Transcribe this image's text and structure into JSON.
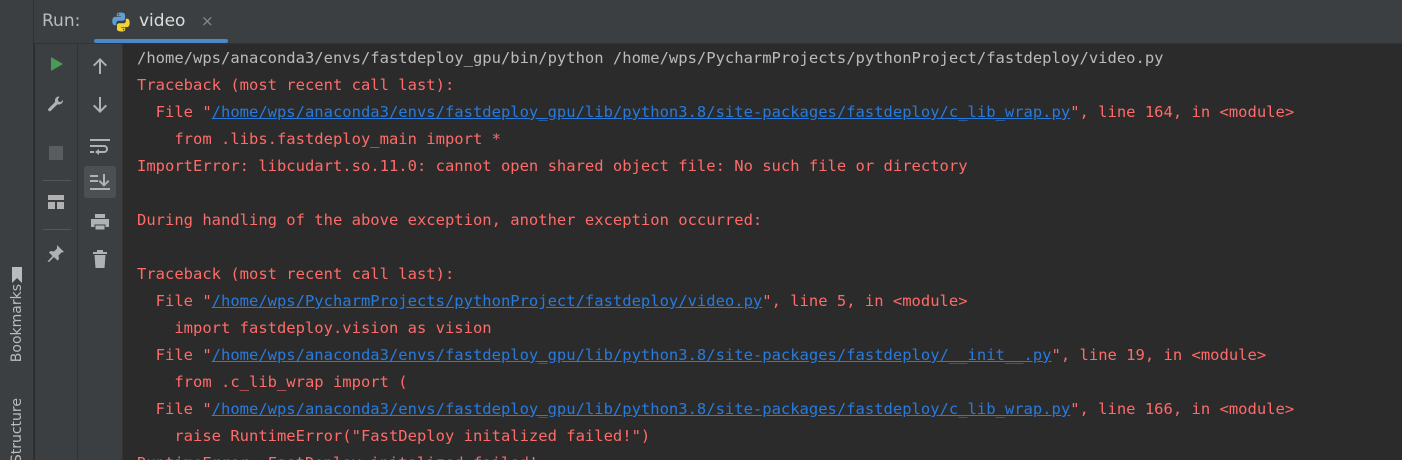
{
  "side_stripe": {
    "bookmarks_label": "Bookmarks",
    "structure_label": "Structure"
  },
  "header": {
    "run_label": "Run:",
    "tab": {
      "title": "video",
      "icon": "python-icon",
      "close_glyph": "×"
    }
  },
  "toolbar": {
    "left": [
      {
        "name": "rerun-icon"
      },
      {
        "name": "wrench-icon"
      },
      {
        "name": "stop-icon"
      },
      {
        "name": "layout-icon"
      },
      {
        "name": "pin-icon"
      }
    ],
    "right": [
      {
        "name": "up-arrow-icon"
      },
      {
        "name": "down-arrow-icon"
      },
      {
        "name": "soft-wrap-icon"
      },
      {
        "name": "scroll-to-end-icon"
      },
      {
        "name": "print-icon"
      },
      {
        "name": "trash-icon"
      }
    ]
  },
  "colors": {
    "error": "#ff6b68",
    "link": "#287bde",
    "normal": "#bbbbbb",
    "background": "#2b2b2b",
    "accent": "#4a88c7"
  },
  "console": {
    "cmd": "/home/wps/anaconda3/envs/fastdeploy_gpu/bin/python /home/wps/PycharmProjects/pythonProject/fastdeploy/video.py",
    "tb1_header": "Traceback (most recent call last):",
    "f1_pre": "  File \"",
    "f1_link": "/home/wps/anaconda3/envs/fastdeploy_gpu/lib/python3.8/site-packages/fastdeploy/c_lib_wrap.py",
    "f1_post": "\", line 164, in <module>",
    "f1_code": "    from .libs.fastdeploy_main import *",
    "import_error": "ImportError: libcudart.so.11.0: cannot open shared object file: No such file or directory",
    "during": "During handling of the above exception, another exception occurred:",
    "tb2_header": "Traceback (most recent call last):",
    "f2_pre": "  File \"",
    "f2_link": "/home/wps/PycharmProjects/pythonProject/fastdeploy/video.py",
    "f2_post": "\", line 5, in <module>",
    "f2_code": "    import fastdeploy.vision as vision",
    "f3_pre": "  File \"",
    "f3_link": "/home/wps/anaconda3/envs/fastdeploy_gpu/lib/python3.8/site-packages/fastdeploy/__init__.py",
    "f3_post": "\", line 19, in <module>",
    "f3_code": "    from .c_lib_wrap import (",
    "f4_pre": "  File \"",
    "f4_link": "/home/wps/anaconda3/envs/fastdeploy_gpu/lib/python3.8/site-packages/fastdeploy/c_lib_wrap.py",
    "f4_post": "\", line 166, in <module>",
    "f4_code": "    raise RuntimeError(\"FastDeploy initalized failed!\")",
    "last_line": "RuntimeError: FastDeploy initalized failed!"
  }
}
